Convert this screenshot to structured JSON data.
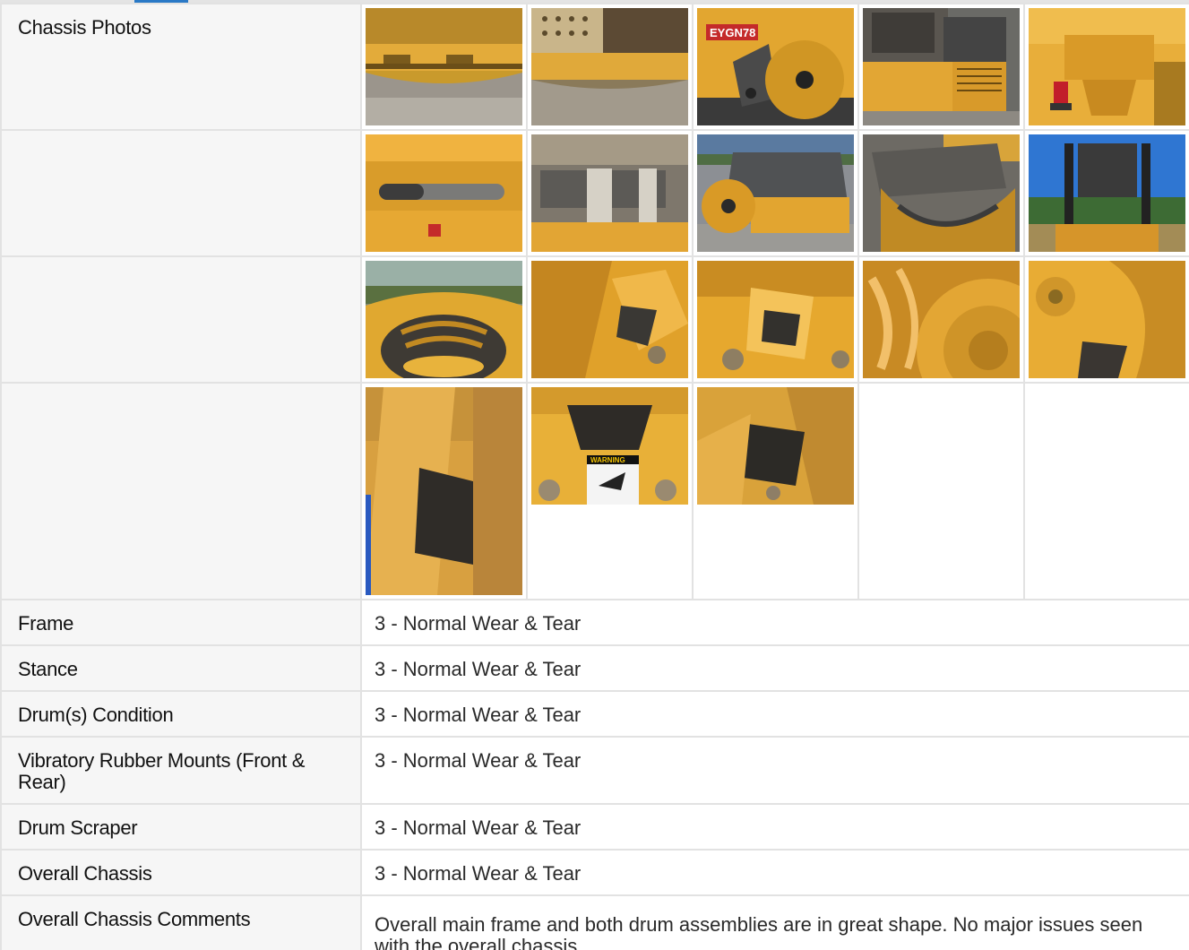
{
  "chassis_photos": {
    "label": "Chassis Photos",
    "rows": [
      [
        {
          "icon": "photo-drum-underside-gravel"
        },
        {
          "icon": "photo-engine-grille-drum"
        },
        {
          "icon": "photo-drum-side-decal"
        },
        {
          "icon": "photo-engine-compartment"
        },
        {
          "icon": "photo-hitch-red-light"
        }
      ],
      [
        {
          "icon": "photo-steering-cylinder"
        },
        {
          "icon": "photo-underside-crossmember"
        },
        {
          "icon": "photo-roller-side-view"
        },
        {
          "icon": "photo-drum-scraper-view"
        },
        {
          "icon": "photo-rear-rops-view"
        }
      ],
      [
        {
          "icon": "photo-drum-end-plate"
        },
        {
          "icon": "photo-drum-mount-closeup-1"
        },
        {
          "icon": "photo-drum-mount-closeup-2"
        },
        {
          "icon": "photo-drum-hub-closeup"
        },
        {
          "icon": "photo-drum-mount-closeup-3"
        }
      ],
      [
        {
          "icon": "photo-rubber-mount-tall"
        },
        {
          "icon": "photo-warning-decal-mount"
        },
        {
          "icon": "photo-rubber-mount-closeup"
        }
      ]
    ],
    "decal_text": "EYGN78",
    "warning_text": "WARNING"
  },
  "inspection": [
    {
      "key": "frame",
      "label": "Frame",
      "value": "3 - Normal Wear & Tear"
    },
    {
      "key": "stance",
      "label": "Stance",
      "value": "3 - Normal Wear & Tear"
    },
    {
      "key": "drum",
      "label": "Drum(s) Condition",
      "value": "3 - Normal Wear & Tear"
    },
    {
      "key": "mounts",
      "label": "Vibratory Rubber Mounts (Front & Rear)",
      "value": "3 - Normal Wear & Tear"
    },
    {
      "key": "scraper",
      "label": "Drum Scraper",
      "value": "3 - Normal Wear & Tear"
    },
    {
      "key": "overall",
      "label": "Overall Chassis",
      "value": "3 - Normal Wear & Tear"
    },
    {
      "key": "comments",
      "label": "Overall Chassis Comments",
      "value": "Overall main frame and both drum assemblies are in great shape. No major issues seen with the overall chassis."
    }
  ],
  "colors": {
    "accent": "#2a79c6",
    "label_bg": "#f6f6f6",
    "border": "#e2e2e2",
    "machine_yellow": "#e8a72c"
  }
}
